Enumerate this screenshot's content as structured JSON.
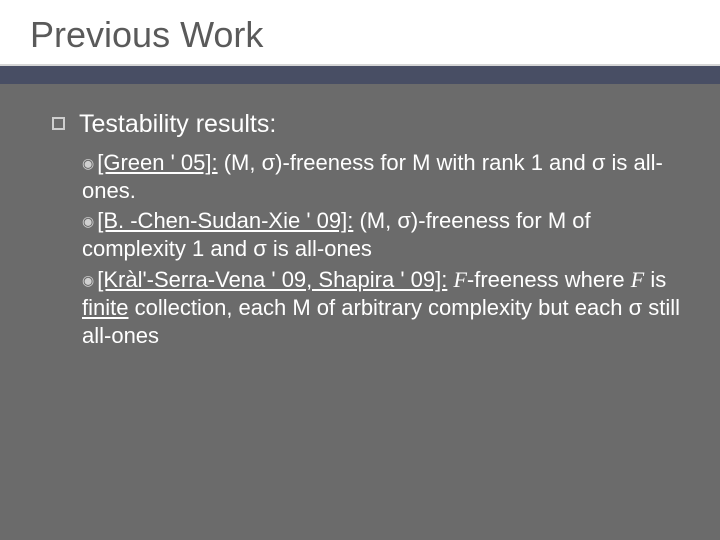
{
  "slide": {
    "title": "Previous Work",
    "heading": "Testability results:",
    "items": [
      {
        "cite": "[Green ' 05]:",
        "rest": " (M, σ)-freeness for M with rank 1 and σ is all-ones."
      },
      {
        "cite": "[B. -Chen-Sudan-Xie ' 09]:",
        "rest": " (M, σ)-freeness for M of complexity 1 and σ is all-ones"
      },
      {
        "cite": "[Kràl'-Serra-Vena ' 09, Shapira ' 09]:",
        "rest_pre": " ",
        "rest_f1": "F",
        "rest_mid": "-freeness where ",
        "rest_f2": "F",
        "rest_mid2": " is ",
        "rest_ul": "finite",
        "rest_post": " collection, each M of arbitrary complexity but each σ still all-ones"
      }
    ]
  }
}
